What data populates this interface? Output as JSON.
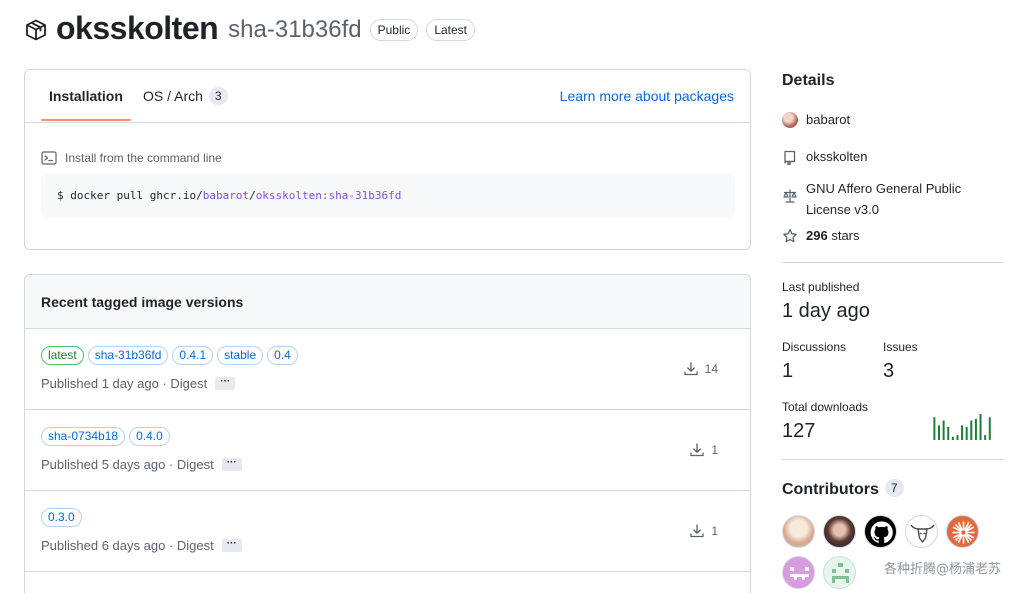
{
  "header": {
    "package_name": "oksskolten",
    "version": "sha-31b36fd",
    "badges": [
      "Public",
      "Latest"
    ]
  },
  "install": {
    "tabs": [
      {
        "label": "Installation",
        "active": true
      },
      {
        "label": "OS / Arch",
        "count": "3"
      }
    ],
    "learn_link": "Learn more about packages",
    "command_label": "Install from the command line",
    "command": {
      "prefix": "$ docker pull ghcr.io/",
      "owner": "babarot",
      "sep": "/",
      "image": "oksskolten:sha-31b36fd"
    }
  },
  "versions": {
    "title": "Recent tagged image versions",
    "rows": [
      {
        "tags": [
          "latest",
          "sha-31b36fd",
          "0.4.1",
          "stable",
          "0.4"
        ],
        "published": "Published 1 day ago · Digest",
        "downloads": "14"
      },
      {
        "tags": [
          "sha-0734b18",
          "0.4.0"
        ],
        "published": "Published 5 days ago · Digest",
        "downloads": "1"
      },
      {
        "tags": [
          "0.3.0"
        ],
        "published": "Published 6 days ago · Digest",
        "downloads": "1"
      }
    ],
    "more_label": "···"
  },
  "details": {
    "title": "Details",
    "owner": "babarot",
    "repo": "oksskolten",
    "license": "GNU Affero General Public License v3.0",
    "stars_count": "296",
    "stars_label": "stars"
  },
  "stats": {
    "last_published_label": "Last published",
    "last_published": "1 day ago",
    "discussions_label": "Discussions",
    "discussions": "1",
    "issues_label": "Issues",
    "issues": "3",
    "total_downloads_label": "Total downloads",
    "total_downloads": "127",
    "download_sparkline": [
      14,
      9,
      12,
      8,
      2,
      3,
      9,
      8,
      12,
      13,
      16,
      3,
      14
    ]
  },
  "contributors": {
    "title": "Contributors",
    "count": "7",
    "avatars": [
      "contributor-avatar-1",
      "contributor-avatar-2",
      "github-icon",
      "bull-icon",
      "starburst-icon",
      "invader-icon",
      "pixel-ghost-icon"
    ]
  },
  "watermark": "各种折腾@杨浦老苏",
  "colors": {
    "link": "#0969da",
    "accent_tab": "#fd8c73",
    "green": "#1a7f37",
    "purple": "#8250df",
    "border": "#d1d9e0"
  }
}
